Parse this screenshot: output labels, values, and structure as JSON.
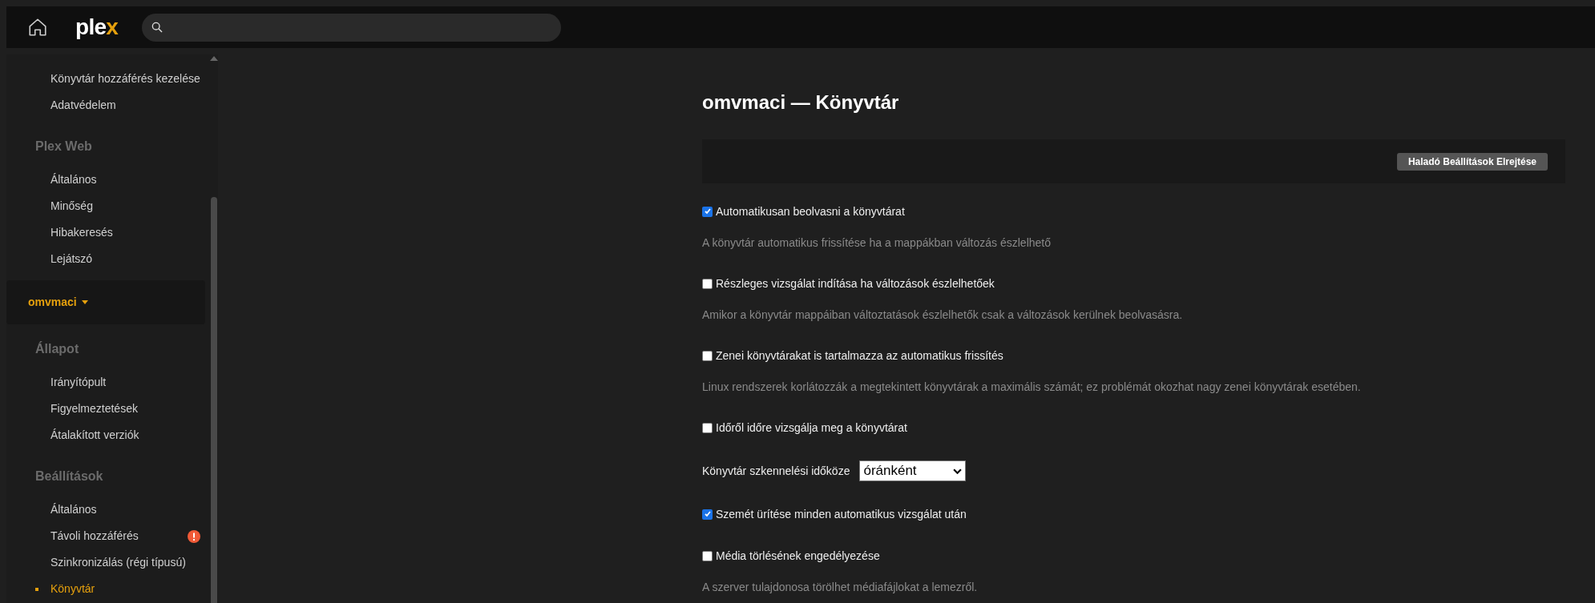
{
  "top_bar": {
    "logo": {
      "text": "ple",
      "accent": "x"
    }
  },
  "sidebar": {
    "groups": [
      {
        "items": [
          {
            "label": "Könyvtár hozzáférés kezelése",
            "selected": false,
            "alert": false
          },
          {
            "label": "Adatvédelem",
            "selected": false,
            "alert": false
          }
        ]
      },
      {
        "heading": "Plex Web",
        "items": [
          {
            "label": "Általános",
            "selected": false,
            "alert": false
          },
          {
            "label": "Minőség",
            "selected": false,
            "alert": false
          },
          {
            "label": "Hibakeresés",
            "selected": false,
            "alert": false
          },
          {
            "label": "Lejátszó",
            "selected": false,
            "alert": false
          }
        ]
      }
    ],
    "server": {
      "name": "omvmaci"
    },
    "server_groups": [
      {
        "heading": "Állapot",
        "items": [
          {
            "label": "Irányítópult",
            "selected": false,
            "alert": false
          },
          {
            "label": "Figyelmeztetések",
            "selected": false,
            "alert": false
          },
          {
            "label": "Átalakított verziók",
            "selected": false,
            "alert": false
          }
        ]
      },
      {
        "heading": "Beállítások",
        "items": [
          {
            "label": "Általános",
            "selected": false,
            "alert": false
          },
          {
            "label": "Távoli hozzáférés",
            "selected": false,
            "alert": true
          },
          {
            "label": "Szinkronizálás (régi típusú)",
            "selected": false,
            "alert": false
          },
          {
            "label": "Könyvtár",
            "selected": true,
            "alert": false
          }
        ]
      }
    ]
  },
  "main": {
    "title": "omvmaci — Könyvtár",
    "advanced_button": "Haladó Beállítások Elrejtése",
    "settings": [
      {
        "kind": "checkbox",
        "label": "Automatikusan beolvasni a könyvtárat",
        "checked": true,
        "description": "A könyvtár automatikus frissítése ha a mappákban változás észlelhető"
      },
      {
        "kind": "checkbox",
        "label": "Részleges vizsgálat indítása ha változások észlelhetőek",
        "checked": false,
        "description": "Amikor a könyvtár mappáiban változtatások észlelhetők csak a változások kerülnek beolvasásra."
      },
      {
        "kind": "checkbox",
        "label": "Zenei könyvtárakat is tartalmazza az automatikus frissítés",
        "checked": false,
        "description": "Linux rendszerek korlátozzák a megtekintett könyvtárak a maximális számát; ez problémát okozhat nagy zenei könyvtárak esetében."
      },
      {
        "kind": "checkbox",
        "label": "Időről időre vizsgálja meg a könyvtárat",
        "checked": false
      },
      {
        "kind": "select",
        "label": "Könyvtár szkennelési időköze",
        "value": "óránként"
      },
      {
        "kind": "checkbox",
        "label": "Szemét ürítése minden automatikus vizsgálat után",
        "checked": true
      },
      {
        "kind": "checkbox",
        "label": "Média törlésének engedélyezése",
        "checked": false,
        "description": "A szerver tulajdonosa törölhet médiafájlokat a lemezről."
      }
    ]
  }
}
